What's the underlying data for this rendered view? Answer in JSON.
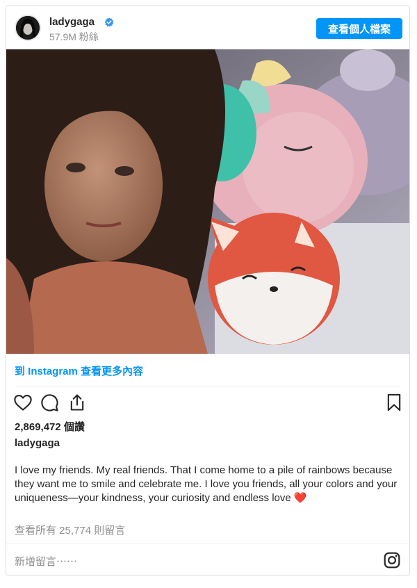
{
  "post": {
    "username": "ladygaga",
    "followers": "57.9M 粉絲",
    "profile_button": "查看個人檔案",
    "view_more_link": "到 Instagram 查看更多內容",
    "likes": "2,869,472 個讚",
    "caption_author": "ladygaga",
    "caption": "I love my friends. My real friends. That I come home to a pile of rainbows because they want me to smile and celebrate me. I love you friends, all your colors and your uniqueness—your kindness, your curiosity and endless love ❤️",
    "view_comments": "查看所有 25,774 則留言",
    "add_comment_placeholder": "新增留言⋯⋯"
  },
  "icons": {
    "verified": "verified-badge-icon",
    "like": "heart-icon",
    "comment": "comment-bubble-icon",
    "share": "share-icon",
    "save": "bookmark-icon",
    "instagram": "instagram-logo-icon"
  },
  "colors": {
    "accent": "#0095f6",
    "text": "#262626",
    "muted": "#8e8e8e",
    "border": "#dbdbdb"
  }
}
